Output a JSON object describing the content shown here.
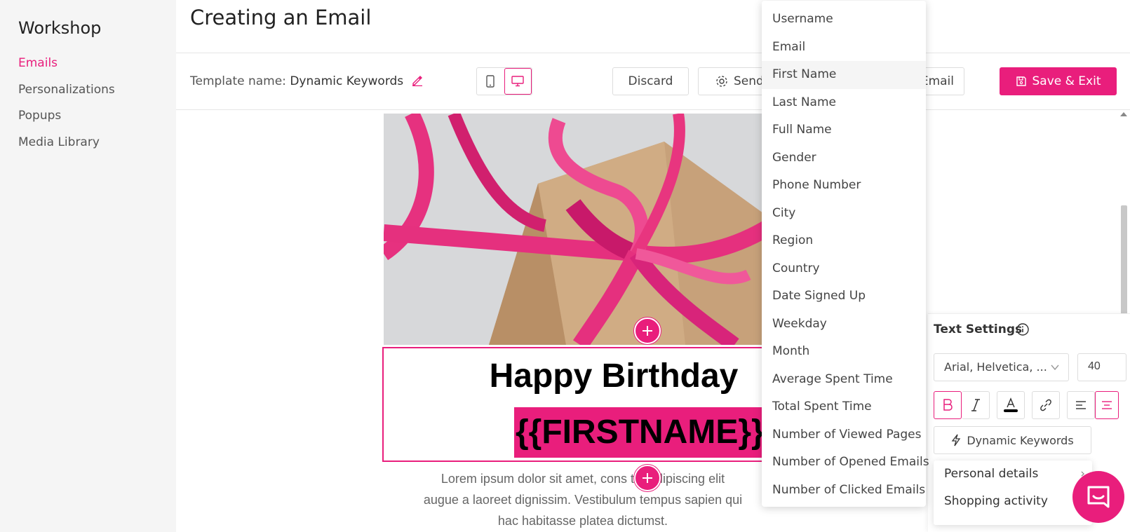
{
  "sidebar": {
    "brand": "Workshop",
    "items": [
      {
        "label": "Emails",
        "active": true
      },
      {
        "label": "Personalizations"
      },
      {
        "label": "Popups"
      },
      {
        "label": "Media Library"
      }
    ]
  },
  "header": {
    "title": "Creating an Email"
  },
  "toolbar": {
    "template_label": "Template name:",
    "template_value": "Dynamic Keywords",
    "discard": "Discard",
    "send": "Send",
    "test_email": "est Email",
    "save_exit": "Save & Exit"
  },
  "canvas": {
    "heading": "Happy Birthday",
    "variable": "{{FIRSTNAME}}",
    "lorem_1": "Lorem ipsum dolor sit amet, cons    tur adipiscing elit",
    "lorem_2": "augue a laoreet dignissim. Vestibulum tempus sapien qui",
    "lorem_3": "hac habitasse platea dictumst."
  },
  "dropdown": {
    "options": [
      "Username",
      "Email",
      "First Name",
      "Last Name",
      "Full Name",
      "Gender",
      "Phone Number",
      "City",
      "Region",
      "Country",
      "Date Signed Up",
      "Weekday",
      "Month",
      "Average Spent Time",
      "Total Spent Time",
      "Number of Viewed Pages",
      "Number of Opened Emails",
      "Number of Clicked Emails"
    ],
    "hovered": "First Name"
  },
  "text_settings": {
    "title": "Text Settings",
    "font_family": "Arial, Helvetica, ...",
    "font_size": "40",
    "dynamic_keywords": "Dynamic Keywords",
    "submenu": [
      "Personal details",
      "Shopping activity"
    ]
  },
  "colors": {
    "accent": "#e91e7c"
  },
  "icons": [
    "pencil-icon",
    "mobile-icon",
    "desktop-icon",
    "gear-icon",
    "save-icon",
    "plus-icon",
    "info-icon",
    "chevron-down-icon",
    "bold-icon",
    "italic-icon",
    "text-color-icon",
    "link-icon",
    "align-left-icon",
    "align-center-icon",
    "lightning-icon",
    "chevron-right-icon",
    "chat-icon"
  ]
}
